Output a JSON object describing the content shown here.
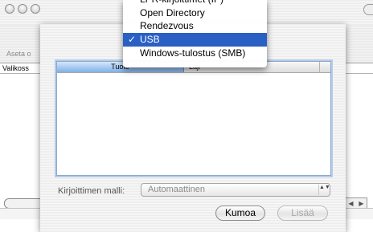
{
  "back_window": {
    "toolbar_label": "Aseta o",
    "list_header": "Valikoss",
    "scroll_arrows": {
      "left": "◀",
      "right": "▶"
    }
  },
  "dialog": {
    "columns": [
      "Tuote",
      "Laji"
    ],
    "printer_model_label": "Kirjoittimen malli:",
    "printer_model_value": "Automaattinen",
    "select_arrows": "▲▼",
    "cancel_button": "Kumoa",
    "add_button": "Lisää"
  },
  "menu": {
    "clipped_item": "LPR-kirjoittimet (IP)",
    "items": [
      {
        "label": "Open Directory",
        "selected": false
      },
      {
        "label": "Rendezvous",
        "selected": false
      },
      {
        "label": "USB",
        "selected": true
      },
      {
        "label": "Windows-tulostus (SMB)",
        "selected": false
      }
    ],
    "check_mark": "✓"
  },
  "colors": {
    "menu_highlight": "#2a5fc4",
    "column_header_selected": "#7fb0ea",
    "list_focus_ring": "#b7cbe6"
  }
}
